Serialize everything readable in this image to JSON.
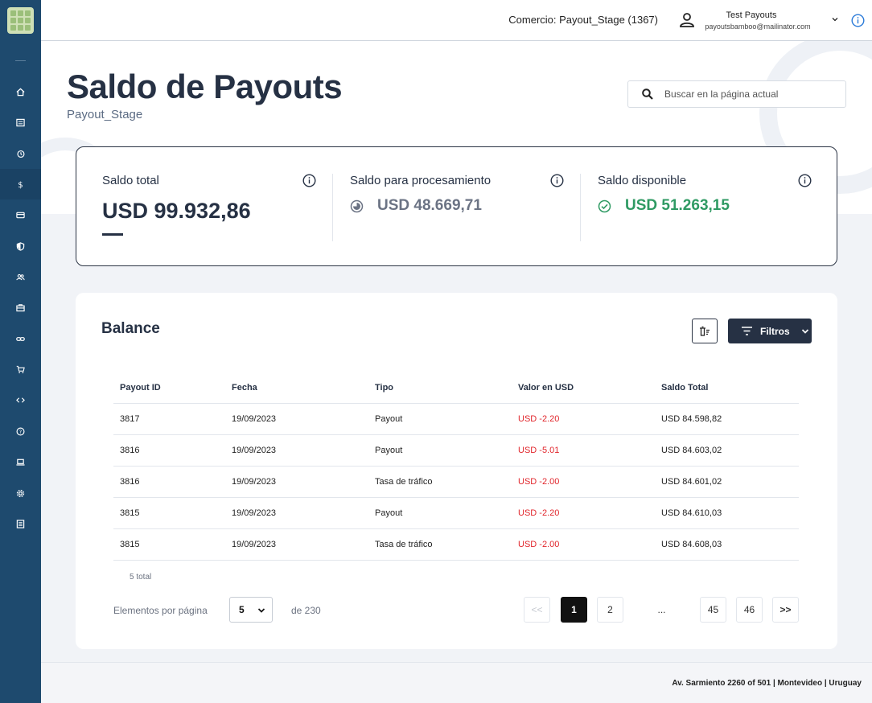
{
  "topbar": {
    "merchant": "Comercio: Payout_Stage (1367)",
    "user_name": "Test Payouts",
    "user_email": "payoutsbamboo@mailinator.com"
  },
  "sidebar": {
    "items": [
      {
        "icon": "home-icon"
      },
      {
        "icon": "list-icon"
      },
      {
        "icon": "history-icon"
      },
      {
        "icon": "dollar-icon",
        "active": true
      },
      {
        "icon": "card-icon"
      },
      {
        "icon": "shield-icon"
      },
      {
        "icon": "users-icon"
      },
      {
        "icon": "briefcase-icon"
      },
      {
        "icon": "link-icon"
      },
      {
        "icon": "cart-icon"
      },
      {
        "icon": "code-icon"
      },
      {
        "icon": "help-icon"
      },
      {
        "icon": "laptop-icon"
      },
      {
        "icon": "settings-icon"
      },
      {
        "icon": "report-icon"
      }
    ]
  },
  "header": {
    "title": "Saldo de Payouts",
    "subtitle": "Payout_Stage",
    "search_placeholder": "Buscar en la página actual"
  },
  "summary": {
    "total_label": "Saldo total",
    "total_value": "USD 99.932,86",
    "processing_label": "Saldo para procesamiento",
    "processing_value": "USD 48.669,71",
    "available_label": "Saldo disponible",
    "available_value": "USD 51.263,15",
    "colors": {
      "processing": "#6b7384",
      "available": "#2f9a63"
    }
  },
  "balance": {
    "title": "Balance",
    "filter_label": "Filtros",
    "columns": [
      "Payout ID",
      "Fecha",
      "Tipo",
      "Valor en USD",
      "Saldo Total"
    ],
    "rows": [
      [
        "3817",
        "19/09/2023",
        "Payout",
        "USD -2.20",
        "USD 84.598,82"
      ],
      [
        "3816",
        "19/09/2023",
        "Payout",
        "USD -5.01",
        "USD 84.603,02"
      ],
      [
        "3816",
        "19/09/2023",
        "Tasa de tráfico",
        "USD -2.00",
        "USD 84.601,02"
      ],
      [
        "3815",
        "19/09/2023",
        "Payout",
        "USD -2.20",
        "USD 84.610,03"
      ],
      [
        "3815",
        "19/09/2023",
        "Tasa de tráfico",
        "USD -2.00",
        "USD 84.608,03"
      ]
    ],
    "total_count": "5 total",
    "per_page_label": "Elementos por página",
    "per_page_value": "5",
    "of_total": "de 230",
    "pagination": {
      "first": "<<",
      "pages": [
        "1",
        "2",
        "...",
        "45",
        "46"
      ],
      "last": ">>",
      "current": "1"
    }
  },
  "footer": {
    "address": "Av. Sarmiento 2260 of 501 | Montevideo | Uruguay"
  },
  "colors": {
    "sidebar": "#1e4a6e",
    "primary": "#263144",
    "negative": "#e1262c"
  }
}
